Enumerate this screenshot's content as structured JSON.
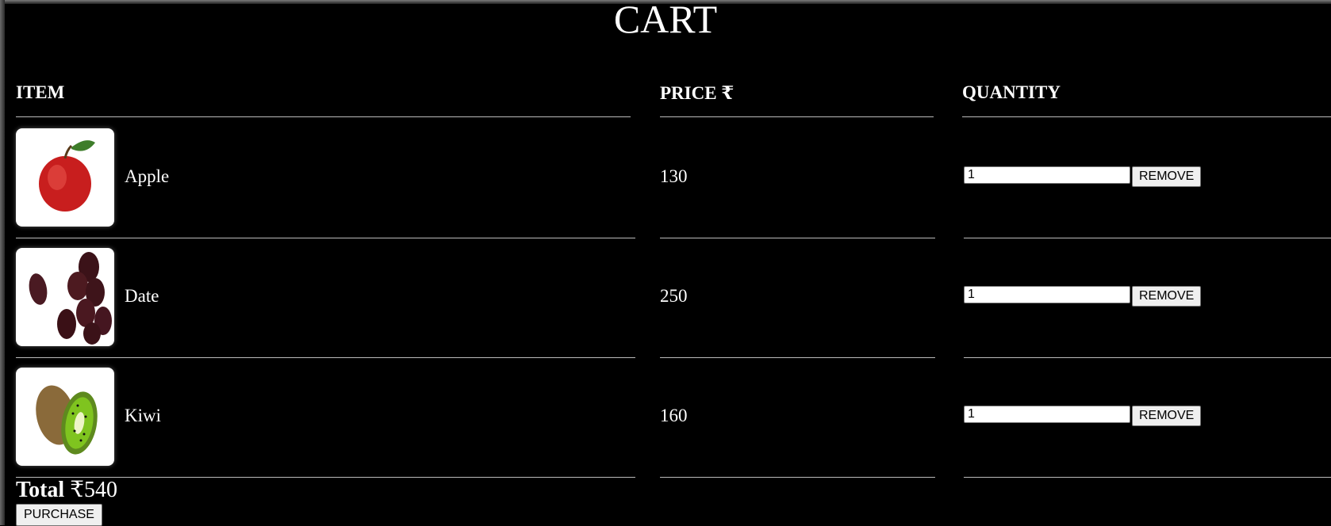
{
  "page_title": "CART",
  "columns": {
    "item": "ITEM",
    "price": "PRICE ₹",
    "quantity": "QUANTITY"
  },
  "items": [
    {
      "name": "Apple",
      "price": "130",
      "quantity": "1",
      "remove_label": "REMOVE",
      "image": "apple"
    },
    {
      "name": "Date",
      "price": "250",
      "quantity": "1",
      "remove_label": "REMOVE",
      "image": "dates"
    },
    {
      "name": "Kiwi",
      "price": "160",
      "quantity": "1",
      "remove_label": "REMOVE",
      "image": "kiwi"
    }
  ],
  "total": {
    "label": "Total",
    "value": "₹540"
  },
  "purchase_label": "PURCHASE"
}
